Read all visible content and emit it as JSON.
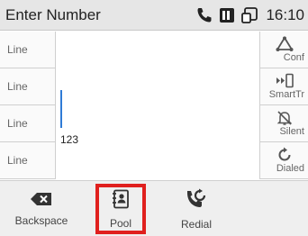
{
  "status_bar": {
    "title": "Enter Number",
    "time": "16:10",
    "icons": [
      "phone-icon",
      "battery-icon",
      "screen-mirror-icon"
    ]
  },
  "line_keys": [
    {
      "label": "Line"
    },
    {
      "label": "Line"
    },
    {
      "label": "Line"
    },
    {
      "label": "Line"
    }
  ],
  "dial": {
    "number": "123"
  },
  "function_keys": [
    {
      "label": "Conf",
      "icon": "conference-icon"
    },
    {
      "label": "SmartTr",
      "icon": "smart-transfer-icon"
    },
    {
      "label": "Silent",
      "icon": "silent-bell-icon"
    },
    {
      "label": "Dialed",
      "icon": "dialed-history-icon"
    }
  ],
  "soft_keys": {
    "backspace": "Backspace",
    "pool": "Pool",
    "redial": "Redial"
  },
  "colors": {
    "highlight": "#e0201e",
    "cursor": "#2f7bd6",
    "status_bg": "#e6e6e6"
  }
}
